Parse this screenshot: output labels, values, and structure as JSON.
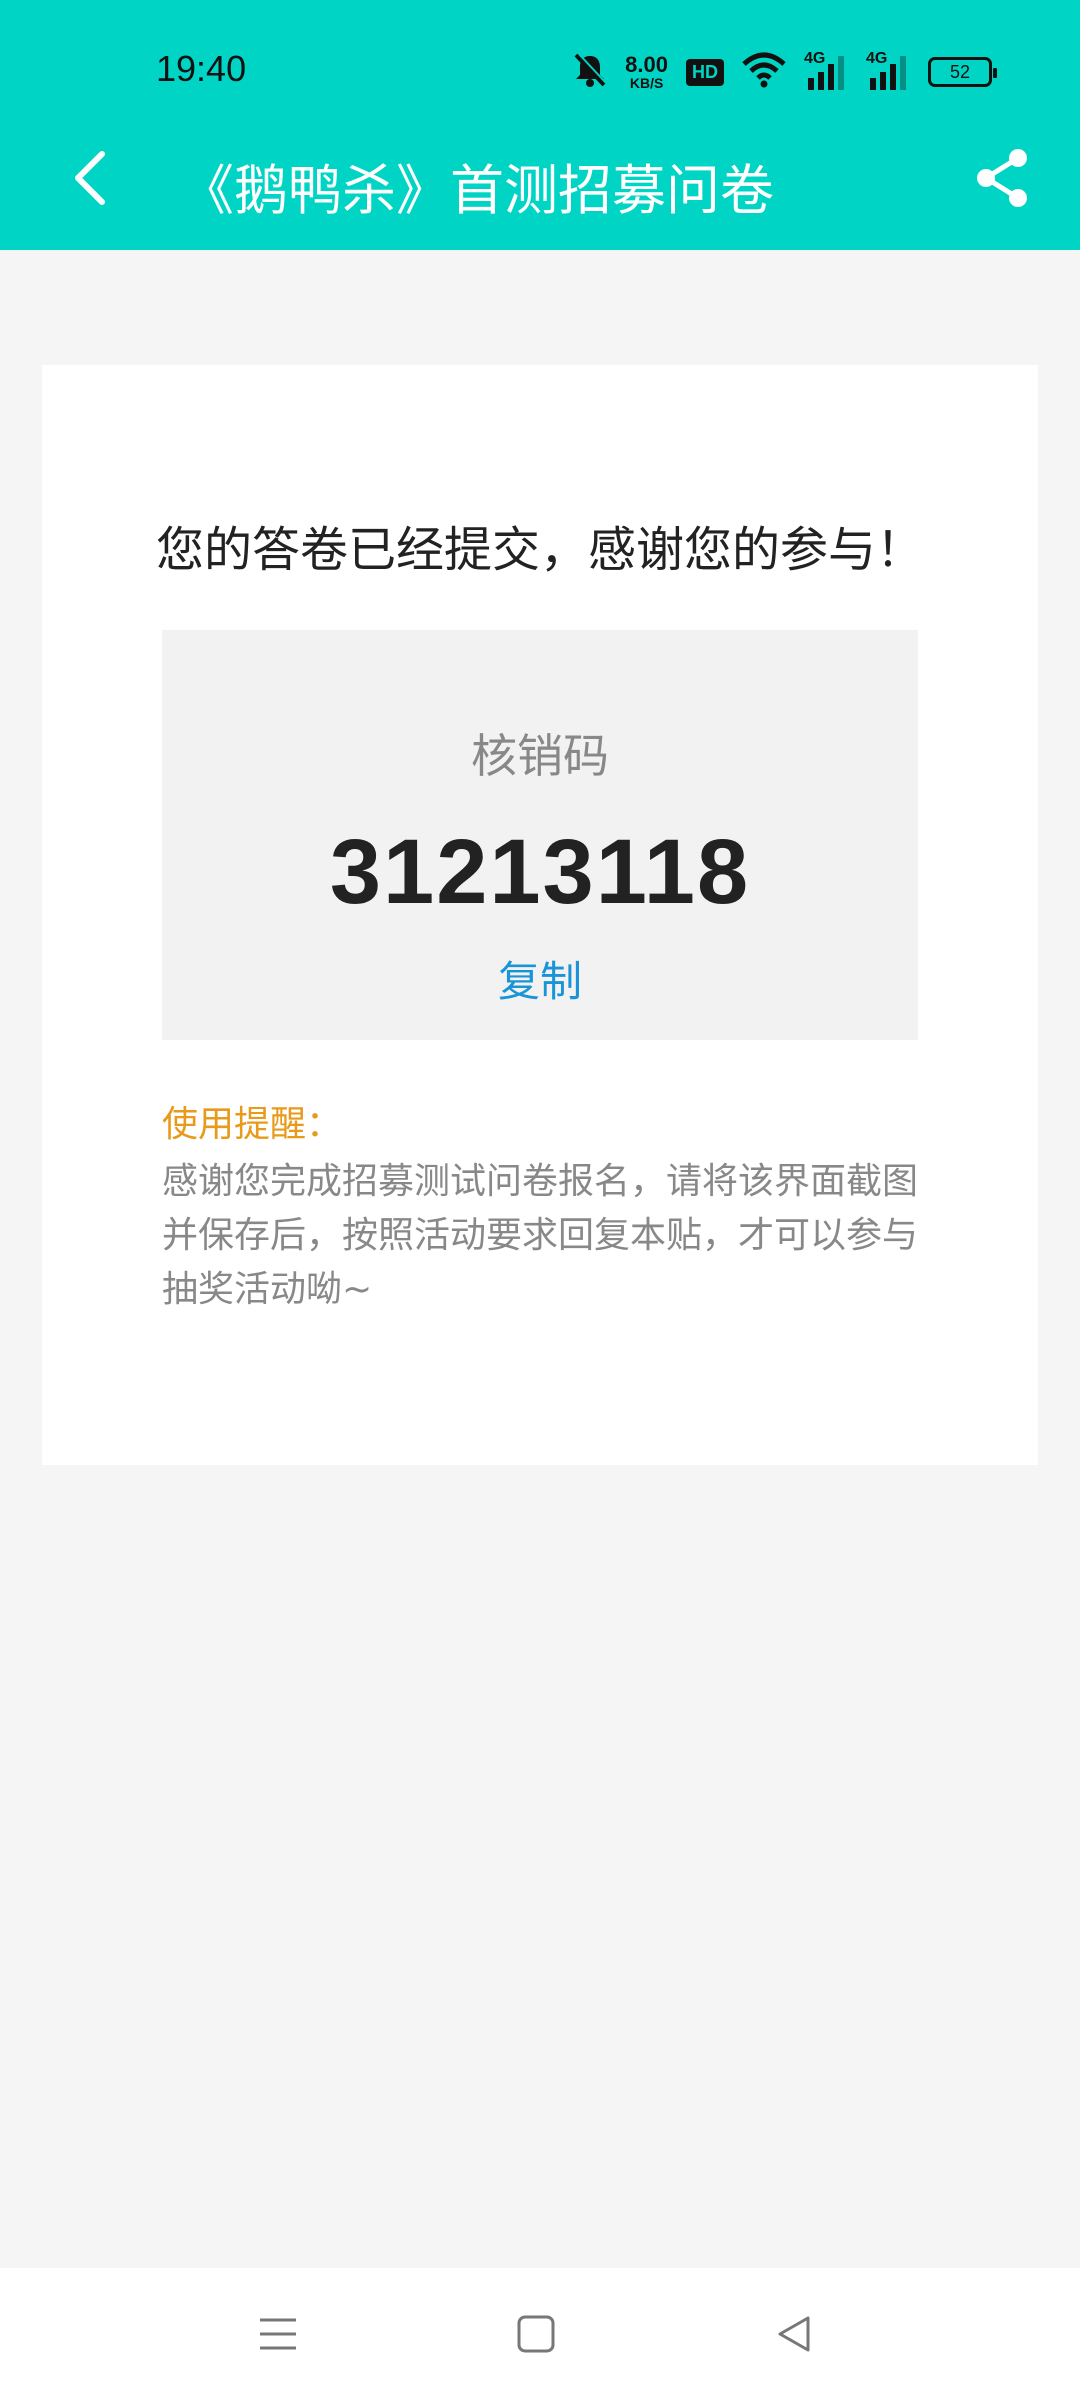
{
  "status_bar": {
    "time": "19:40",
    "net_speed_value": "8.00",
    "net_speed_unit": "KB/S",
    "hd_label": "HD",
    "signal1_label": "4G",
    "signal2_label": "4G",
    "battery": "52"
  },
  "header": {
    "title": "《鹅鸭杀》首测招募问卷",
    "background_color": "#00d4c4"
  },
  "card": {
    "message": "您的答卷已经提交，感谢您的参与！",
    "code_label": "核销码",
    "code_value": "31213118",
    "copy_label": "复制",
    "tip_title": "使用提醒：",
    "tip_text": "感谢您完成招募测试问卷报名，请将该界面截图并保存后，按照活动要求回复本贴，才可以参与抽奖活动呦~",
    "accent_color": "#1a94d8",
    "tip_color": "#e89a1a"
  },
  "icons": {
    "back": "back-arrow-icon",
    "share": "share-icon",
    "mute": "bell-off-icon",
    "wifi": "wifi-icon",
    "menu": "menu-icon",
    "home": "home-icon",
    "nav_back": "back-triangle-icon"
  }
}
